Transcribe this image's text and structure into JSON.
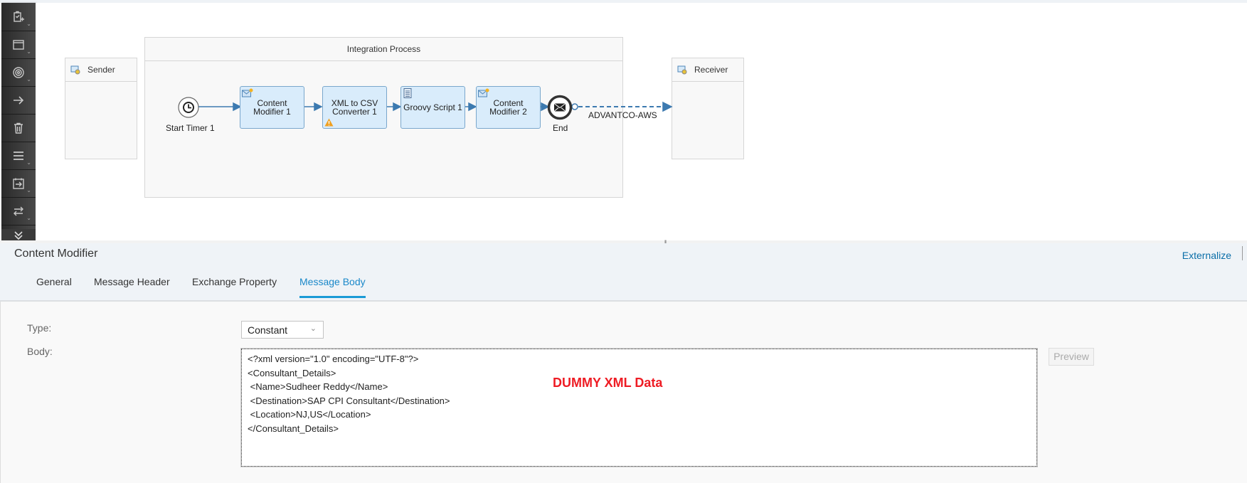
{
  "toolbar": {
    "items": [
      {
        "icon": "participant-add-icon",
        "has_menu": true
      },
      {
        "icon": "process-icon",
        "has_menu": true
      },
      {
        "icon": "events-icon",
        "has_menu": true
      },
      {
        "icon": "connector-arrow-icon",
        "has_menu": false
      },
      {
        "icon": "delete-icon",
        "has_menu": false
      },
      {
        "icon": "mapping-list-icon",
        "has_menu": true
      },
      {
        "icon": "call-icon",
        "has_menu": true
      },
      {
        "icon": "routing-icon",
        "has_menu": true
      }
    ],
    "collapse_icon": "double-chevron-down-icon"
  },
  "diagram": {
    "sender": {
      "label": "Sender",
      "icon": "participant-icon"
    },
    "receiver": {
      "label": "Receiver",
      "icon": "participant-icon"
    },
    "process": {
      "title": "Integration Process"
    },
    "start_event": {
      "label": "Start Timer 1",
      "icon": "clock-icon"
    },
    "steps": [
      {
        "label_line1": "Content",
        "label_line2": "Modifier 1",
        "icon": "content-modifier-icon",
        "warning": false
      },
      {
        "label_line1": "XML to CSV",
        "label_line2": "Converter 1",
        "icon": "",
        "warning": true
      },
      {
        "label_line1": "Groovy Script 1",
        "label_line2": "",
        "icon": "script-icon",
        "warning": false
      },
      {
        "label_line1": "Content",
        "label_line2": "Modifier 2",
        "icon": "content-modifier-icon",
        "warning": false
      }
    ],
    "end_event": {
      "label": "End",
      "icon": "envelope-icon"
    },
    "connection_label": "ADVANTCO-AWS",
    "colors": {
      "step_fill": "#d9ecfb",
      "step_border": "#7aa7cc",
      "flow": "#3d7ab0",
      "warning": "#f0a020"
    }
  },
  "panel": {
    "title": "Content Modifier",
    "externalize_label": "Externalize",
    "tabs": [
      {
        "label": "General",
        "active": false
      },
      {
        "label": "Message Header",
        "active": false
      },
      {
        "label": "Exchange Property",
        "active": false
      },
      {
        "label": "Message Body",
        "active": true
      }
    ],
    "type_label": "Type:",
    "type_value": "Constant",
    "body_label": "Body:",
    "body_lines": [
      "<?xml version=\"1.0\" encoding=\"UTF-8\"?>",
      "<Consultant_Details>",
      " <Name>Sudheer Reddy</Name>",
      " <Destination>SAP CPI Consultant</Destination>",
      " <Location>NJ,US</Location>",
      "</Consultant_Details>"
    ],
    "overlay_note": "DUMMY XML Data",
    "preview_label": "Preview",
    "accent_color": "#1a88c9"
  }
}
